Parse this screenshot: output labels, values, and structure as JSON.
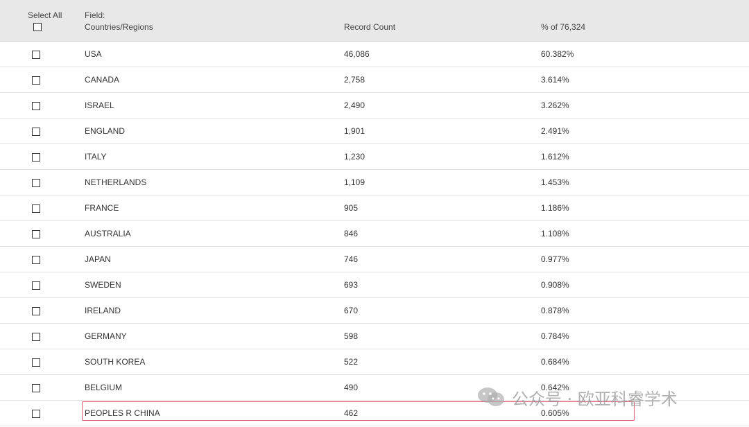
{
  "header": {
    "select_all": "Select All",
    "field_label": "Field:",
    "field_value": "Countries/Regions",
    "record_count": "Record Count",
    "percent_of": "% of 76,324"
  },
  "rows": [
    {
      "country": "USA",
      "count": "46,086",
      "percent": "60.382%"
    },
    {
      "country": "CANADA",
      "count": "2,758",
      "percent": "3.614%"
    },
    {
      "country": "ISRAEL",
      "count": "2,490",
      "percent": "3.262%"
    },
    {
      "country": "ENGLAND",
      "count": "1,901",
      "percent": "2.491%"
    },
    {
      "country": "ITALY",
      "count": "1,230",
      "percent": "1.612%"
    },
    {
      "country": "NETHERLANDS",
      "count": "1,109",
      "percent": "1.453%"
    },
    {
      "country": "FRANCE",
      "count": "905",
      "percent": "1.186%"
    },
    {
      "country": "AUSTRALIA",
      "count": "846",
      "percent": "1.108%"
    },
    {
      "country": "JAPAN",
      "count": "746",
      "percent": "0.977%"
    },
    {
      "country": "SWEDEN",
      "count": "693",
      "percent": "0.908%"
    },
    {
      "country": "IRELAND",
      "count": "670",
      "percent": "0.878%"
    },
    {
      "country": "GERMANY",
      "count": "598",
      "percent": "0.784%"
    },
    {
      "country": "SOUTH KOREA",
      "count": "522",
      "percent": "0.684%"
    },
    {
      "country": "BELGIUM",
      "count": "490",
      "percent": "0.642%"
    },
    {
      "country": "PEOPLES R CHINA",
      "count": "462",
      "percent": "0.605%"
    }
  ],
  "watermark": {
    "text": "公众号 · 欧亚科睿学术",
    "icon": "wechat-icon"
  },
  "colors": {
    "header_bg": "#e8e8e8",
    "highlight_border": "#e0596c"
  }
}
